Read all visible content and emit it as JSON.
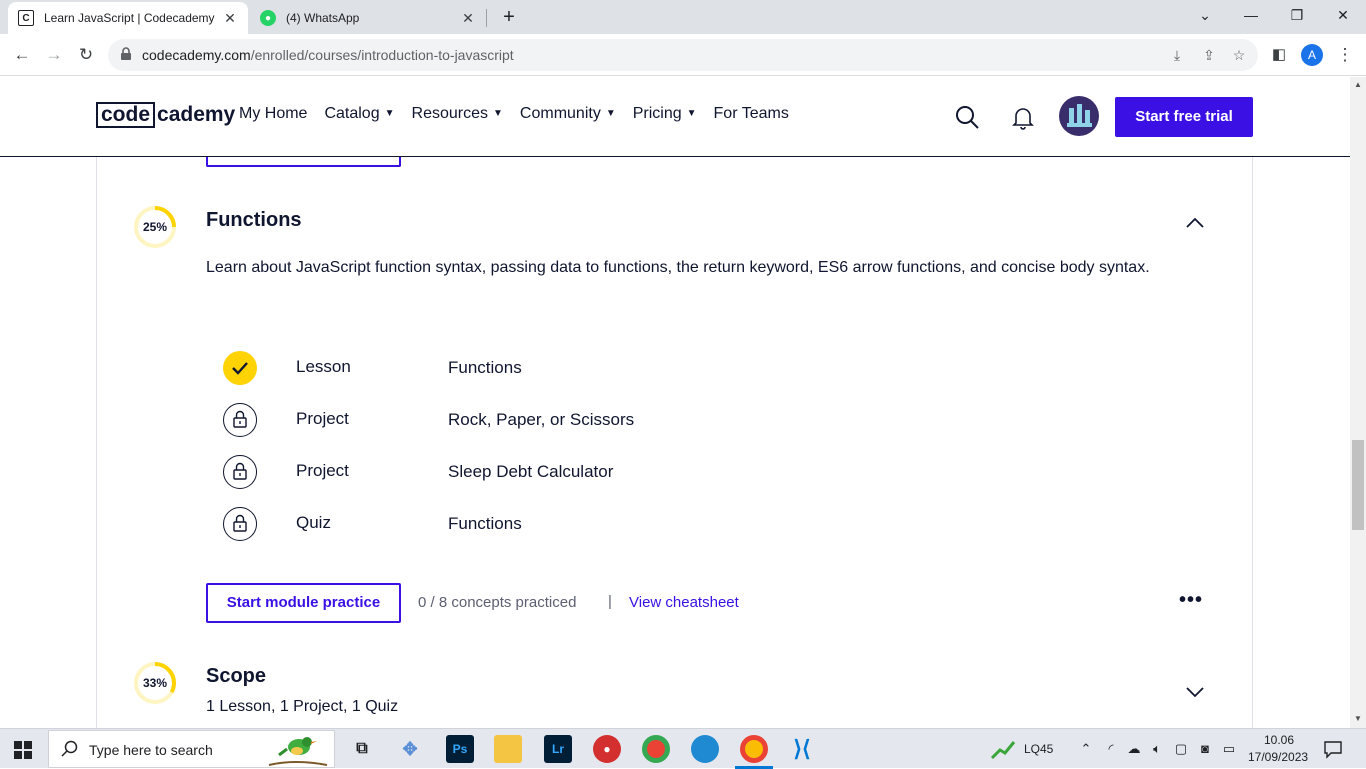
{
  "browser": {
    "tabs": [
      {
        "title": "Learn JavaScript | Codecademy",
        "favicon": "codecademy-icon",
        "active": true
      },
      {
        "title": "(4) WhatsApp",
        "favicon": "whatsapp-icon",
        "active": false
      }
    ],
    "url_host": "codecademy.com",
    "url_path": "/enrolled/courses/introduction-to-javascript",
    "profile_initial": "A"
  },
  "site": {
    "logo_code": "code",
    "logo_rest": "cademy",
    "nav": [
      "My Home",
      "Catalog",
      "Resources",
      "Community",
      "Pricing",
      "For Teams"
    ],
    "nav_has_caret": [
      false,
      true,
      true,
      true,
      true,
      false
    ],
    "cta": "Start free trial",
    "brand_color": "#3a10e5"
  },
  "modules": {
    "functions": {
      "progress": "25%",
      "progress_value": 0.25,
      "title": "Functions",
      "description": "Learn about JavaScript function syntax, passing data to functions, the return keyword, ES6 arrow functions, and concise body syntax.",
      "items": [
        {
          "kind": "Lesson",
          "name": "Functions",
          "status": "completed"
        },
        {
          "kind": "Project",
          "name": "Rock, Paper, or Scissors",
          "status": "locked"
        },
        {
          "kind": "Project",
          "name": "Sleep Debt Calculator",
          "status": "locked"
        },
        {
          "kind": "Quiz",
          "name": "Functions",
          "status": "locked"
        }
      ],
      "practice_button": "Start module practice",
      "concepts": "0 / 8 concepts practiced",
      "separator": "|",
      "cheatsheet": "View cheatsheet",
      "more": "•••"
    },
    "scope": {
      "progress": "33%",
      "progress_value": 0.33,
      "title": "Scope",
      "summary": "1 Lesson, 1 Project, 1 Quiz"
    }
  },
  "taskbar": {
    "search_placeholder": "Type here to search",
    "weather_label": "LQ45",
    "time": "10.06",
    "date": "17/09/2023"
  }
}
